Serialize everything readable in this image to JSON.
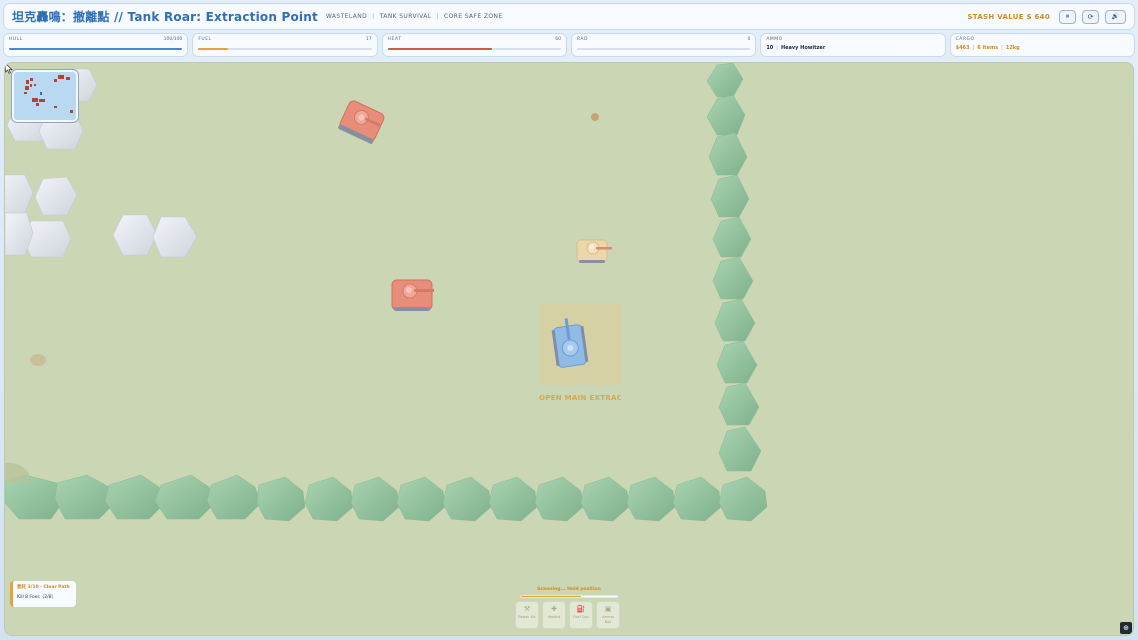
{
  "header": {
    "title": "坦克轟鳴：撤離點 // Tank Roar: Extraction Point",
    "tags": [
      "WASTELAND",
      "TANK SURVIVAL",
      "CORE SAFE ZONE"
    ],
    "stash_value": "STASH VALUE $ 640",
    "buttons": [
      {
        "icon": "pause-icon",
        "glyph": "⏸"
      },
      {
        "icon": "restart-icon",
        "glyph": "⟳"
      },
      {
        "icon": "sound-icon",
        "glyph": "🔊"
      }
    ]
  },
  "stats": {
    "hull": {
      "label": "HULL",
      "value": "100/100",
      "fraction": 1.0,
      "color": "#4a86d6"
    },
    "fuel": {
      "label": "FUEL",
      "value": "17",
      "fraction": 0.17,
      "color": "#e3a23b"
    },
    "heat": {
      "label": "HEAT",
      "value": "60",
      "fraction": 0.6,
      "color": "#cf5a45"
    },
    "rad": {
      "label": "RAD",
      "value": "0",
      "fraction": 0.0,
      "color": "#7a9c4a"
    },
    "ammo": {
      "label": "AMMO",
      "count": "10",
      "weapon": "Heavy Howitzer"
    },
    "cargo": {
      "label": "CARGO",
      "money": "$463",
      "items": "6 items",
      "weight": "12kg"
    }
  },
  "objective": {
    "line1": "委託 3/10 · Clear Path",
    "line2": "Kill 8 Foes（2/8）"
  },
  "scan": {
    "text": "Scanning... Hold position",
    "progress": 0.62
  },
  "extract_label": "OPEN MAIN EXTRACT",
  "actions": [
    {
      "label": "Repair Kit",
      "icon": "wrench-icon",
      "glyph": "⚒"
    },
    {
      "label": "Medkit",
      "icon": "bandage-icon",
      "glyph": "✚"
    },
    {
      "label": "Fuel Can",
      "icon": "fuel-can-icon",
      "glyph": "⛽"
    },
    {
      "label": "Ammo Box",
      "icon": "ammo-box-icon",
      "glyph": "▣"
    }
  ],
  "colors": {
    "ground": "#cbd6b5",
    "enemy_tank": "#e88d7a",
    "player_tank": "#8fbbe6",
    "neutral_tank": "#ead7aa",
    "tree": "#9cc7a6",
    "rock": "#e4e7ee",
    "extract_zone": "#d9cfa0"
  }
}
